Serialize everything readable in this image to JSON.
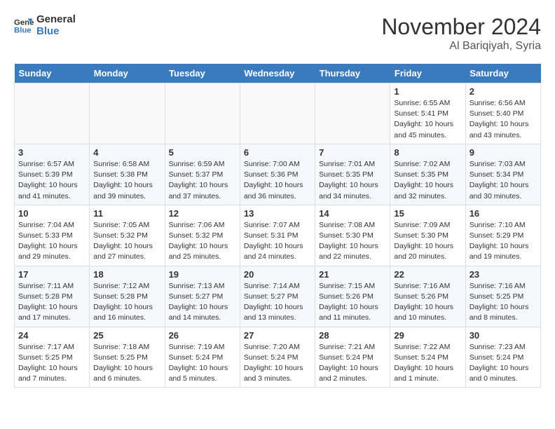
{
  "header": {
    "logo_line1": "General",
    "logo_line2": "Blue",
    "month": "November 2024",
    "location": "Al Bariqiyah, Syria"
  },
  "weekdays": [
    "Sunday",
    "Monday",
    "Tuesday",
    "Wednesday",
    "Thursday",
    "Friday",
    "Saturday"
  ],
  "weeks": [
    [
      {
        "day": "",
        "info": ""
      },
      {
        "day": "",
        "info": ""
      },
      {
        "day": "",
        "info": ""
      },
      {
        "day": "",
        "info": ""
      },
      {
        "day": "",
        "info": ""
      },
      {
        "day": "1",
        "info": "Sunrise: 6:55 AM\nSunset: 5:41 PM\nDaylight: 10 hours\nand 45 minutes."
      },
      {
        "day": "2",
        "info": "Sunrise: 6:56 AM\nSunset: 5:40 PM\nDaylight: 10 hours\nand 43 minutes."
      }
    ],
    [
      {
        "day": "3",
        "info": "Sunrise: 6:57 AM\nSunset: 5:39 PM\nDaylight: 10 hours\nand 41 minutes."
      },
      {
        "day": "4",
        "info": "Sunrise: 6:58 AM\nSunset: 5:38 PM\nDaylight: 10 hours\nand 39 minutes."
      },
      {
        "day": "5",
        "info": "Sunrise: 6:59 AM\nSunset: 5:37 PM\nDaylight: 10 hours\nand 37 minutes."
      },
      {
        "day": "6",
        "info": "Sunrise: 7:00 AM\nSunset: 5:36 PM\nDaylight: 10 hours\nand 36 minutes."
      },
      {
        "day": "7",
        "info": "Sunrise: 7:01 AM\nSunset: 5:35 PM\nDaylight: 10 hours\nand 34 minutes."
      },
      {
        "day": "8",
        "info": "Sunrise: 7:02 AM\nSunset: 5:35 PM\nDaylight: 10 hours\nand 32 minutes."
      },
      {
        "day": "9",
        "info": "Sunrise: 7:03 AM\nSunset: 5:34 PM\nDaylight: 10 hours\nand 30 minutes."
      }
    ],
    [
      {
        "day": "10",
        "info": "Sunrise: 7:04 AM\nSunset: 5:33 PM\nDaylight: 10 hours\nand 29 minutes."
      },
      {
        "day": "11",
        "info": "Sunrise: 7:05 AM\nSunset: 5:32 PM\nDaylight: 10 hours\nand 27 minutes."
      },
      {
        "day": "12",
        "info": "Sunrise: 7:06 AM\nSunset: 5:32 PM\nDaylight: 10 hours\nand 25 minutes."
      },
      {
        "day": "13",
        "info": "Sunrise: 7:07 AM\nSunset: 5:31 PM\nDaylight: 10 hours\nand 24 minutes."
      },
      {
        "day": "14",
        "info": "Sunrise: 7:08 AM\nSunset: 5:30 PM\nDaylight: 10 hours\nand 22 minutes."
      },
      {
        "day": "15",
        "info": "Sunrise: 7:09 AM\nSunset: 5:30 PM\nDaylight: 10 hours\nand 20 minutes."
      },
      {
        "day": "16",
        "info": "Sunrise: 7:10 AM\nSunset: 5:29 PM\nDaylight: 10 hours\nand 19 minutes."
      }
    ],
    [
      {
        "day": "17",
        "info": "Sunrise: 7:11 AM\nSunset: 5:28 PM\nDaylight: 10 hours\nand 17 minutes."
      },
      {
        "day": "18",
        "info": "Sunrise: 7:12 AM\nSunset: 5:28 PM\nDaylight: 10 hours\nand 16 minutes."
      },
      {
        "day": "19",
        "info": "Sunrise: 7:13 AM\nSunset: 5:27 PM\nDaylight: 10 hours\nand 14 minutes."
      },
      {
        "day": "20",
        "info": "Sunrise: 7:14 AM\nSunset: 5:27 PM\nDaylight: 10 hours\nand 13 minutes."
      },
      {
        "day": "21",
        "info": "Sunrise: 7:15 AM\nSunset: 5:26 PM\nDaylight: 10 hours\nand 11 minutes."
      },
      {
        "day": "22",
        "info": "Sunrise: 7:16 AM\nSunset: 5:26 PM\nDaylight: 10 hours\nand 10 minutes."
      },
      {
        "day": "23",
        "info": "Sunrise: 7:16 AM\nSunset: 5:25 PM\nDaylight: 10 hours\nand 8 minutes."
      }
    ],
    [
      {
        "day": "24",
        "info": "Sunrise: 7:17 AM\nSunset: 5:25 PM\nDaylight: 10 hours\nand 7 minutes."
      },
      {
        "day": "25",
        "info": "Sunrise: 7:18 AM\nSunset: 5:25 PM\nDaylight: 10 hours\nand 6 minutes."
      },
      {
        "day": "26",
        "info": "Sunrise: 7:19 AM\nSunset: 5:24 PM\nDaylight: 10 hours\nand 5 minutes."
      },
      {
        "day": "27",
        "info": "Sunrise: 7:20 AM\nSunset: 5:24 PM\nDaylight: 10 hours\nand 3 minutes."
      },
      {
        "day": "28",
        "info": "Sunrise: 7:21 AM\nSunset: 5:24 PM\nDaylight: 10 hours\nand 2 minutes."
      },
      {
        "day": "29",
        "info": "Sunrise: 7:22 AM\nSunset: 5:24 PM\nDaylight: 10 hours\nand 1 minute."
      },
      {
        "day": "30",
        "info": "Sunrise: 7:23 AM\nSunset: 5:24 PM\nDaylight: 10 hours\nand 0 minutes."
      }
    ]
  ]
}
